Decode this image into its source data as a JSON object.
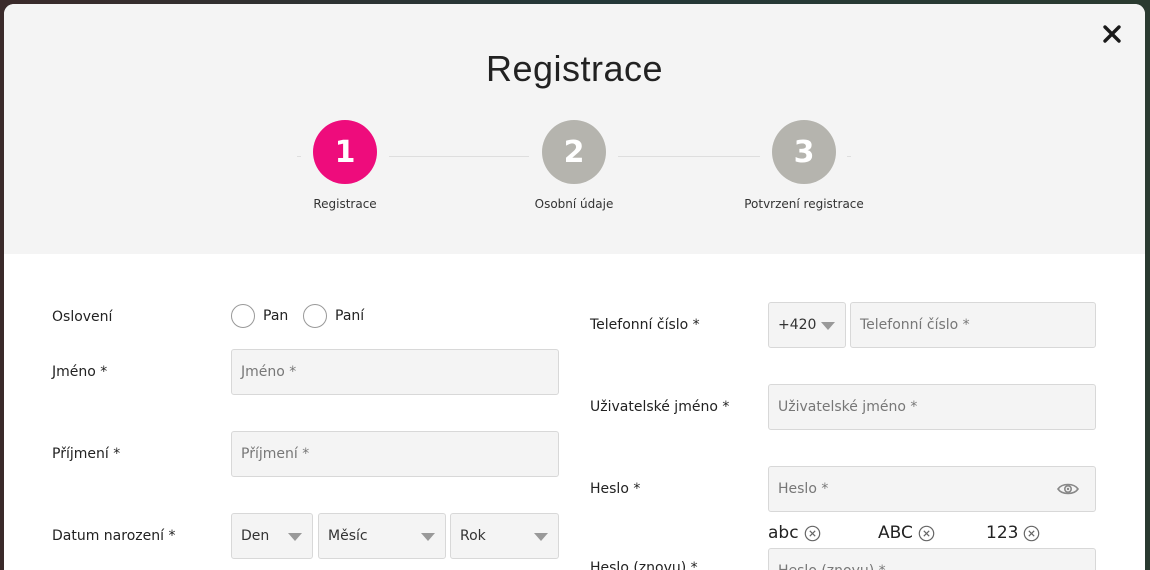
{
  "modal": {
    "title": "Registrace",
    "close_label": "×"
  },
  "steps": [
    {
      "number": "1",
      "label": "Registrace",
      "active": true
    },
    {
      "number": "2",
      "label": "Osobní údaje",
      "active": false
    },
    {
      "number": "3",
      "label": "Potvrzení registrace",
      "active": false
    }
  ],
  "form": {
    "salutation": {
      "label": "Oslovení",
      "options": [
        "Pan",
        "Paní"
      ]
    },
    "first_name": {
      "label": "Jméno *",
      "placeholder": "Jméno *"
    },
    "last_name": {
      "label": "Příjmení *",
      "placeholder": "Příjmení *"
    },
    "birth_date": {
      "label": "Datum narození *",
      "day": "Den",
      "month": "Měsíc",
      "year": "Rok"
    },
    "phone": {
      "label": "Telefonní číslo *",
      "prefix": "+420",
      "placeholder": "Telefonní číslo *"
    },
    "username": {
      "label": "Uživatelské jméno *",
      "placeholder": "Uživatelské jméno *"
    },
    "password": {
      "label": "Heslo *",
      "placeholder": "Heslo *",
      "rules": [
        "abc",
        "ABC",
        "123"
      ]
    },
    "password_repeat": {
      "label": "Heslo (znovu) *",
      "placeholder": "Heslo (znovu) *"
    }
  },
  "colors": {
    "accent": "#ee0c7c",
    "inactive_step": "#b5b4ae",
    "header_bg": "#f4f4f4"
  }
}
